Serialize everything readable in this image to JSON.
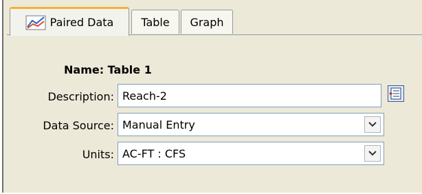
{
  "tabs": [
    {
      "label": "Paired Data",
      "active": true,
      "icon": "paired-data-chart-icon"
    },
    {
      "label": "Table",
      "active": false
    },
    {
      "label": "Graph",
      "active": false
    }
  ],
  "form": {
    "name_label": "Name: Table 1",
    "description_label": "Description:",
    "description_value": "Reach-2",
    "data_source_label": "Data Source:",
    "data_source_value": "Manual Entry",
    "units_label": "Units:",
    "units_value": "AC-FT : CFS"
  },
  "colors": {
    "background": "#ece9d8",
    "active_tab_accent": "#f8b037",
    "field_border": "#7f9db9"
  }
}
